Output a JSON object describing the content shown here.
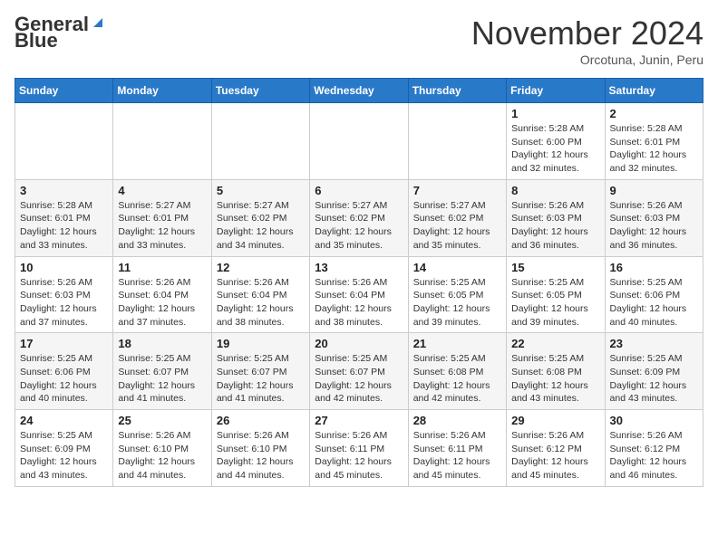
{
  "header": {
    "logo_general": "General",
    "logo_blue": "Blue",
    "title": "November 2024",
    "location": "Orcotuna, Junin, Peru"
  },
  "weekdays": [
    "Sunday",
    "Monday",
    "Tuesday",
    "Wednesday",
    "Thursday",
    "Friday",
    "Saturday"
  ],
  "weeks": [
    [
      {
        "day": "",
        "info": ""
      },
      {
        "day": "",
        "info": ""
      },
      {
        "day": "",
        "info": ""
      },
      {
        "day": "",
        "info": ""
      },
      {
        "day": "",
        "info": ""
      },
      {
        "day": "1",
        "sunrise": "Sunrise: 5:28 AM",
        "sunset": "Sunset: 6:00 PM",
        "daylight": "Daylight: 12 hours and 32 minutes."
      },
      {
        "day": "2",
        "sunrise": "Sunrise: 5:28 AM",
        "sunset": "Sunset: 6:01 PM",
        "daylight": "Daylight: 12 hours and 32 minutes."
      }
    ],
    [
      {
        "day": "3",
        "sunrise": "Sunrise: 5:28 AM",
        "sunset": "Sunset: 6:01 PM",
        "daylight": "Daylight: 12 hours and 33 minutes."
      },
      {
        "day": "4",
        "sunrise": "Sunrise: 5:27 AM",
        "sunset": "Sunset: 6:01 PM",
        "daylight": "Daylight: 12 hours and 33 minutes."
      },
      {
        "day": "5",
        "sunrise": "Sunrise: 5:27 AM",
        "sunset": "Sunset: 6:02 PM",
        "daylight": "Daylight: 12 hours and 34 minutes."
      },
      {
        "day": "6",
        "sunrise": "Sunrise: 5:27 AM",
        "sunset": "Sunset: 6:02 PM",
        "daylight": "Daylight: 12 hours and 35 minutes."
      },
      {
        "day": "7",
        "sunrise": "Sunrise: 5:27 AM",
        "sunset": "Sunset: 6:02 PM",
        "daylight": "Daylight: 12 hours and 35 minutes."
      },
      {
        "day": "8",
        "sunrise": "Sunrise: 5:26 AM",
        "sunset": "Sunset: 6:03 PM",
        "daylight": "Daylight: 12 hours and 36 minutes."
      },
      {
        "day": "9",
        "sunrise": "Sunrise: 5:26 AM",
        "sunset": "Sunset: 6:03 PM",
        "daylight": "Daylight: 12 hours and 36 minutes."
      }
    ],
    [
      {
        "day": "10",
        "sunrise": "Sunrise: 5:26 AM",
        "sunset": "Sunset: 6:03 PM",
        "daylight": "Daylight: 12 hours and 37 minutes."
      },
      {
        "day": "11",
        "sunrise": "Sunrise: 5:26 AM",
        "sunset": "Sunset: 6:04 PM",
        "daylight": "Daylight: 12 hours and 37 minutes."
      },
      {
        "day": "12",
        "sunrise": "Sunrise: 5:26 AM",
        "sunset": "Sunset: 6:04 PM",
        "daylight": "Daylight: 12 hours and 38 minutes."
      },
      {
        "day": "13",
        "sunrise": "Sunrise: 5:26 AM",
        "sunset": "Sunset: 6:04 PM",
        "daylight": "Daylight: 12 hours and 38 minutes."
      },
      {
        "day": "14",
        "sunrise": "Sunrise: 5:25 AM",
        "sunset": "Sunset: 6:05 PM",
        "daylight": "Daylight: 12 hours and 39 minutes."
      },
      {
        "day": "15",
        "sunrise": "Sunrise: 5:25 AM",
        "sunset": "Sunset: 6:05 PM",
        "daylight": "Daylight: 12 hours and 39 minutes."
      },
      {
        "day": "16",
        "sunrise": "Sunrise: 5:25 AM",
        "sunset": "Sunset: 6:06 PM",
        "daylight": "Daylight: 12 hours and 40 minutes."
      }
    ],
    [
      {
        "day": "17",
        "sunrise": "Sunrise: 5:25 AM",
        "sunset": "Sunset: 6:06 PM",
        "daylight": "Daylight: 12 hours and 40 minutes."
      },
      {
        "day": "18",
        "sunrise": "Sunrise: 5:25 AM",
        "sunset": "Sunset: 6:07 PM",
        "daylight": "Daylight: 12 hours and 41 minutes."
      },
      {
        "day": "19",
        "sunrise": "Sunrise: 5:25 AM",
        "sunset": "Sunset: 6:07 PM",
        "daylight": "Daylight: 12 hours and 41 minutes."
      },
      {
        "day": "20",
        "sunrise": "Sunrise: 5:25 AM",
        "sunset": "Sunset: 6:07 PM",
        "daylight": "Daylight: 12 hours and 42 minutes."
      },
      {
        "day": "21",
        "sunrise": "Sunrise: 5:25 AM",
        "sunset": "Sunset: 6:08 PM",
        "daylight": "Daylight: 12 hours and 42 minutes."
      },
      {
        "day": "22",
        "sunrise": "Sunrise: 5:25 AM",
        "sunset": "Sunset: 6:08 PM",
        "daylight": "Daylight: 12 hours and 43 minutes."
      },
      {
        "day": "23",
        "sunrise": "Sunrise: 5:25 AM",
        "sunset": "Sunset: 6:09 PM",
        "daylight": "Daylight: 12 hours and 43 minutes."
      }
    ],
    [
      {
        "day": "24",
        "sunrise": "Sunrise: 5:25 AM",
        "sunset": "Sunset: 6:09 PM",
        "daylight": "Daylight: 12 hours and 43 minutes."
      },
      {
        "day": "25",
        "sunrise": "Sunrise: 5:26 AM",
        "sunset": "Sunset: 6:10 PM",
        "daylight": "Daylight: 12 hours and 44 minutes."
      },
      {
        "day": "26",
        "sunrise": "Sunrise: 5:26 AM",
        "sunset": "Sunset: 6:10 PM",
        "daylight": "Daylight: 12 hours and 44 minutes."
      },
      {
        "day": "27",
        "sunrise": "Sunrise: 5:26 AM",
        "sunset": "Sunset: 6:11 PM",
        "daylight": "Daylight: 12 hours and 45 minutes."
      },
      {
        "day": "28",
        "sunrise": "Sunrise: 5:26 AM",
        "sunset": "Sunset: 6:11 PM",
        "daylight": "Daylight: 12 hours and 45 minutes."
      },
      {
        "day": "29",
        "sunrise": "Sunrise: 5:26 AM",
        "sunset": "Sunset: 6:12 PM",
        "daylight": "Daylight: 12 hours and 45 minutes."
      },
      {
        "day": "30",
        "sunrise": "Sunrise: 5:26 AM",
        "sunset": "Sunset: 6:12 PM",
        "daylight": "Daylight: 12 hours and 46 minutes."
      }
    ]
  ]
}
